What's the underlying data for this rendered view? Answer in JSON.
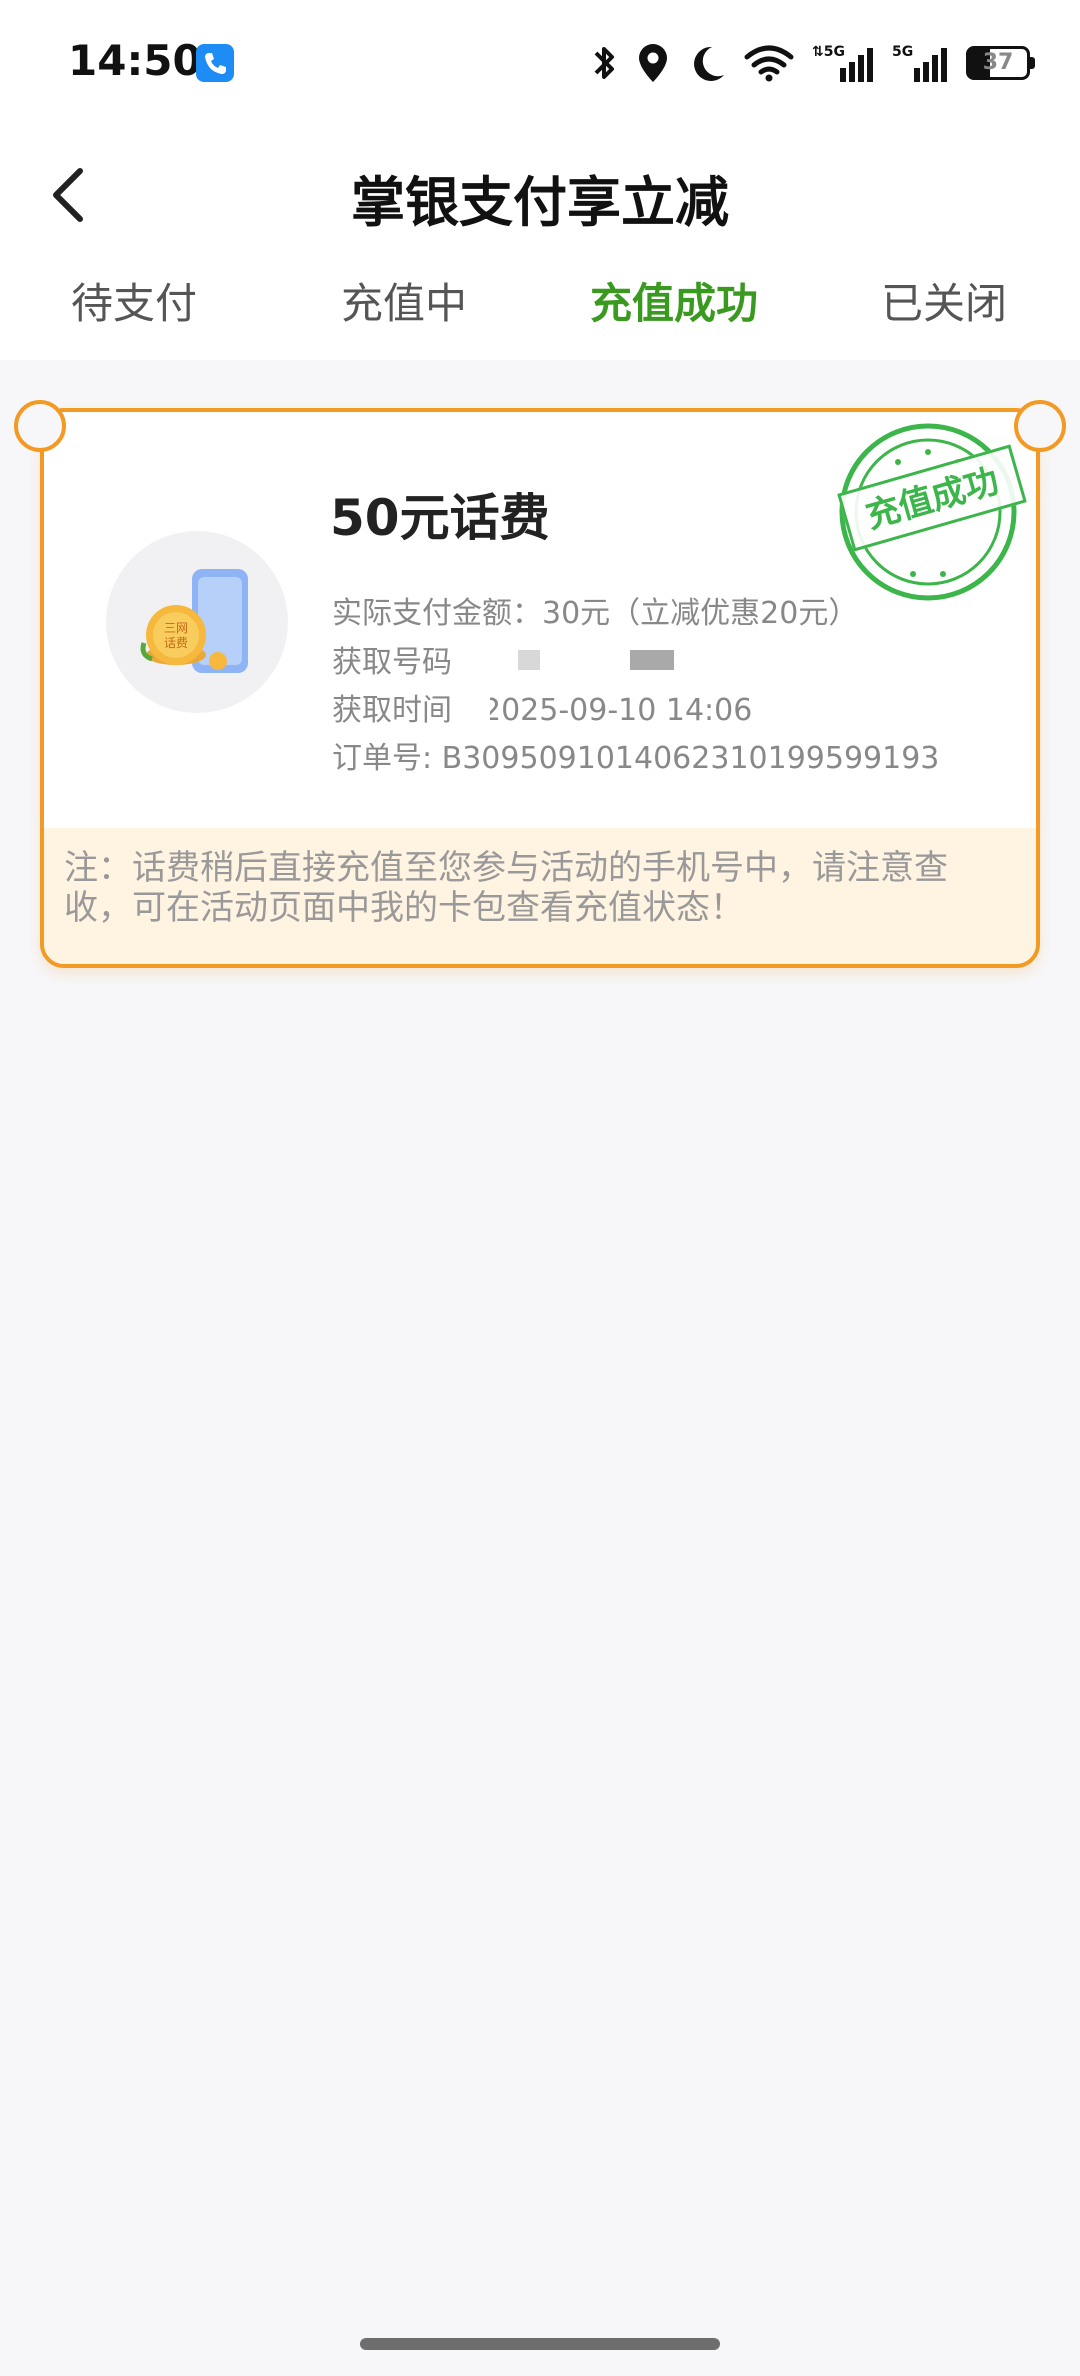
{
  "status_bar": {
    "time": "14:50",
    "battery_level": "37",
    "network_1": "5G",
    "network_2": "5G",
    "icons": [
      "phone-call-icon",
      "bluetooth-icon",
      "location-icon",
      "moon-icon",
      "wifi-icon",
      "signal-icon",
      "signal-icon",
      "battery-icon"
    ]
  },
  "header": {
    "title": "掌银支付享立减",
    "back_icon": "chevron-left-icon"
  },
  "tabs": [
    {
      "label": "待支付",
      "active": false
    },
    {
      "label": "充值中",
      "active": false
    },
    {
      "label": "充值成功",
      "active": true
    },
    {
      "label": "已关闭",
      "active": false
    }
  ],
  "order": {
    "product_title": "50元话费",
    "paid_amount": "实际支付金额：30元（立减优惠20元）",
    "phone_label": "获取号码",
    "time_label": "获取时间：2025-09-10 14:06",
    "order_no": "订单号: B30950910140623101995991​93",
    "stamp_text": "充值成功",
    "thumb_badge": "三网话费",
    "note": "注：话费稍后直接充值至您参与活动的手机号中，请注意查收，可在活动页面中我的卡包查看充值状态！"
  },
  "colors": {
    "accent_green": "#3a9a20",
    "card_border": "#f39a25",
    "note_bg": "#fff3e2",
    "stamp_green": "#3cb54a"
  }
}
